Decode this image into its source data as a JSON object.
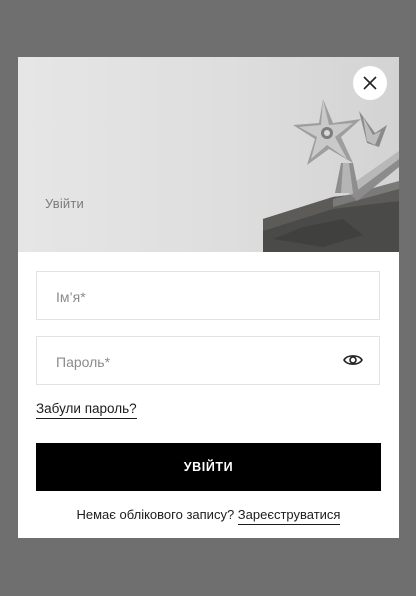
{
  "hero": {
    "title": "Увійти"
  },
  "form": {
    "name_placeholder": "Ім’я*",
    "password_placeholder": "Пароль*",
    "forgot_label": "Забули пароль?",
    "submit_label": "УВІЙТИ",
    "register_prompt": "Немає облікового запису?",
    "register_link": "Зареєструватися"
  },
  "icons": {
    "close": "close-icon",
    "eye": "eye-icon"
  },
  "colors": {
    "overlay": "#6f6f6f",
    "button": "#000000",
    "hero_bg": "#e0e0e0"
  }
}
